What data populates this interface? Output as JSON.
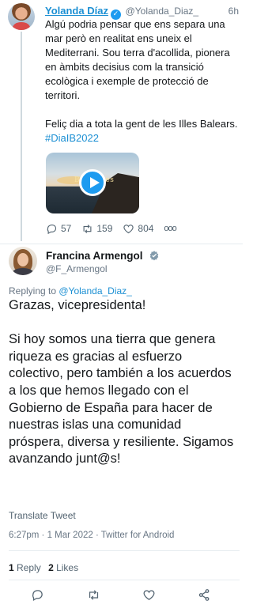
{
  "parent_tweet": {
    "author_name": "Yolanda Díaz",
    "verified_badge": "✓",
    "handle": "@Yolanda_Diaz_",
    "time": "6h",
    "text_main": "Algú podria pensar que ens separa una mar però en realitat ens uneix el Mediterrani. Sou terra d'acollida, pionera en àmbits decisius com la transició ecològica i exemple de protecció de territori.\n\nFeliç dia a tota la gent de les Illes Balears. ",
    "hashtag": "#DiaIB2022",
    "video_caption": "Bona Illes",
    "actions": {
      "replies": "57",
      "retweets": "159",
      "likes": "804",
      "more": "ooo"
    },
    "icons": [
      "reply-icon",
      "retweet-icon",
      "like-icon",
      "more-icon",
      "play-icon"
    ]
  },
  "main_tweet": {
    "author_name": "Francina Armengol",
    "handle": "@F_Armengol",
    "replying_prefix": "Replying to ",
    "replying_to": "@Yolanda_Diaz_",
    "text": "Grazas, vicepresidenta!\n\nSi hoy somos una tierra que genera riqueza es gracias al esfuerzo colectivo, pero también a los acuerdos a los que hemos llegado con el Gobierno de España para hacer de nuestras islas una comunidad próspera, diversa y resiliente. Sigamos avanzando junt@s!",
    "translate_label": "Translate Tweet",
    "meta": "6:27pm · 1 Mar 2022 · Twitter for Android",
    "stats": {
      "retweets_count": "1",
      "retweets_label": "Reply",
      "likes_count": "2",
      "likes_label": "Likes"
    },
    "icons": [
      "reply-icon",
      "retweet-icon",
      "like-icon",
      "share-icon"
    ]
  },
  "colors": {
    "accent": "#1b8fd3",
    "muted": "#687684",
    "text": "#14171a",
    "divider": "#e6ecf0"
  }
}
